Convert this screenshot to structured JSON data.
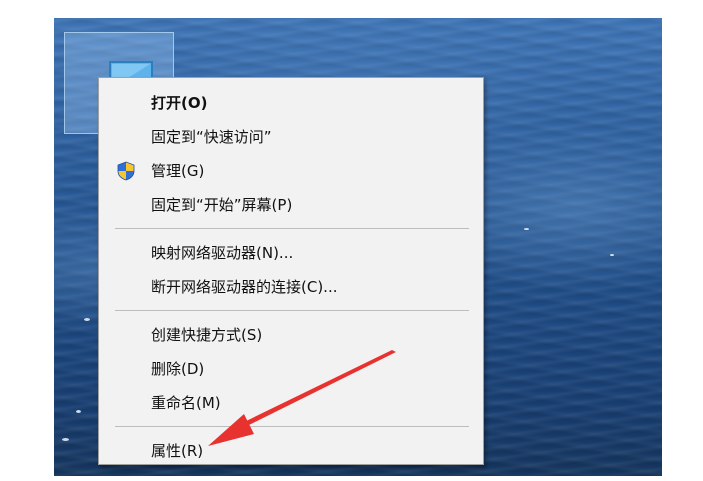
{
  "desktop": {
    "icon_name": "monitor-icon"
  },
  "context_menu": {
    "groups": [
      [
        {
          "label": "打开(O)",
          "bold": true
        },
        {
          "label": "固定到“快速访问”"
        },
        {
          "label": "管理(G)",
          "icon": "uac-shield-icon"
        },
        {
          "label": "固定到“开始”屏幕(P)"
        }
      ],
      [
        {
          "label": "映射网络驱动器(N)..."
        },
        {
          "label": "断开网络驱动器的连接(C)..."
        }
      ],
      [
        {
          "label": "创建快捷方式(S)"
        },
        {
          "label": "删除(D)"
        },
        {
          "label": "重命名(M)"
        }
      ],
      [
        {
          "label": "属性(R)"
        }
      ]
    ]
  },
  "annotation": {
    "arrow_color": "#e8322f",
    "points_to": "属性(R)"
  }
}
